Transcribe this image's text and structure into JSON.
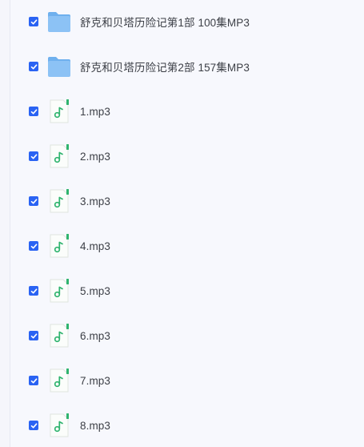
{
  "files": [
    {
      "name": "舒克和贝塔历险记第1部 100集MP3",
      "type": "folder",
      "checked": true,
      "icon": "folder-icon"
    },
    {
      "name": "舒克和贝塔历险记第2部 157集MP3",
      "type": "folder",
      "checked": true,
      "icon": "folder-icon"
    },
    {
      "name": "1.mp3",
      "type": "audio",
      "checked": true,
      "icon": "music-file-icon"
    },
    {
      "name": "2.mp3",
      "type": "audio",
      "checked": true,
      "icon": "music-file-icon"
    },
    {
      "name": "3.mp3",
      "type": "audio",
      "checked": true,
      "icon": "music-file-icon"
    },
    {
      "name": "4.mp3",
      "type": "audio",
      "checked": true,
      "icon": "music-file-icon"
    },
    {
      "name": "5.mp3",
      "type": "audio",
      "checked": true,
      "icon": "music-file-icon"
    },
    {
      "name": "6.mp3",
      "type": "audio",
      "checked": true,
      "icon": "music-file-icon"
    },
    {
      "name": "7.mp3",
      "type": "audio",
      "checked": true,
      "icon": "music-file-icon"
    },
    {
      "name": "8.mp3",
      "type": "audio",
      "checked": true,
      "icon": "music-file-icon"
    }
  ],
  "colors": {
    "checkbox": "#2a63f3",
    "folder": "#8cc2f5",
    "audio_accent": "#2fb46e",
    "text": "#3c3f46",
    "background": "#f7f8fd"
  }
}
